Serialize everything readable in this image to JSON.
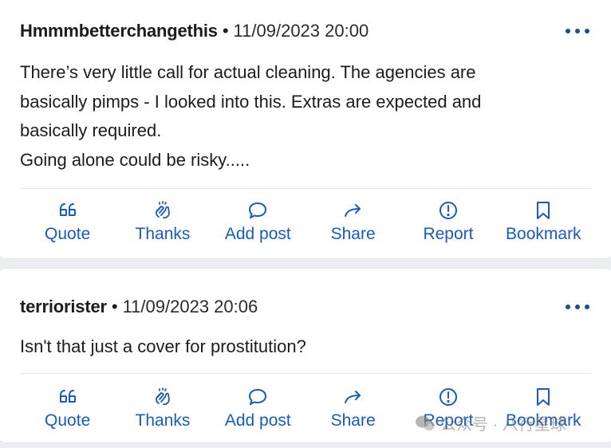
{
  "posts": [
    {
      "username": "Hmmmbetterchangethis",
      "separator": "•",
      "timestamp": "11/09/2023 20:00",
      "body": [
        "There’s very little call for actual cleaning. The agencies are",
        "basically pimps - I looked into this. Extras are expected and",
        "basically required.",
        "Going alone could be risky....."
      ]
    },
    {
      "username": "terriorister",
      "separator": "•",
      "timestamp": "11/09/2023 20:06",
      "body": [
        "Isn't that just a cover for prostitution?"
      ]
    }
  ],
  "actions": {
    "quote": "Quote",
    "thanks": "Thanks",
    "add_post": "Add post",
    "share": "Share",
    "report": "Report",
    "bookmark": "Bookmark"
  },
  "watermark": {
    "text": "公众号 · 八行星球"
  },
  "colors": {
    "accent": "#1a5bb5",
    "background": "#eceef2",
    "card": "#ffffff"
  }
}
